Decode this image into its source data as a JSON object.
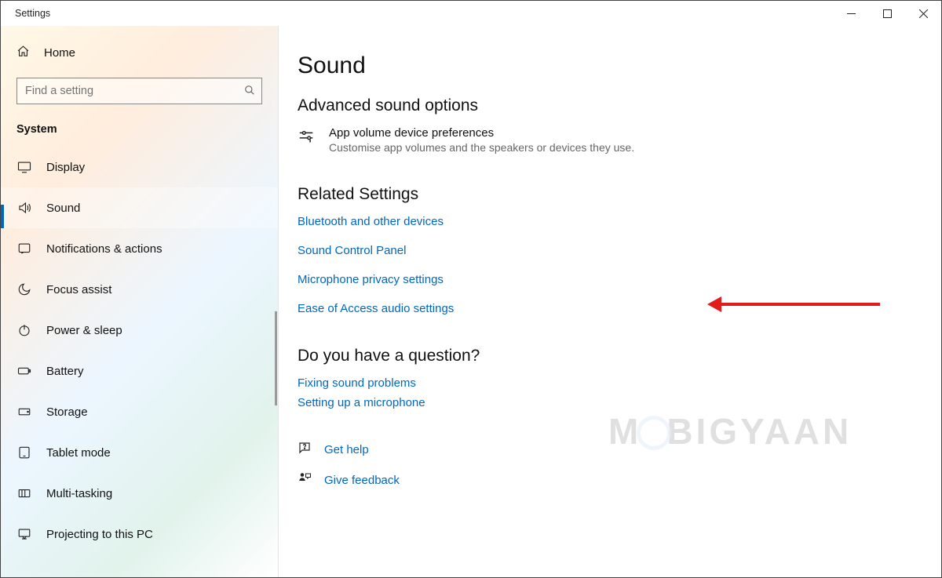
{
  "titlebar": {
    "title": "Settings"
  },
  "sidebar": {
    "home_label": "Home",
    "search_placeholder": "Find a setting",
    "section_label": "System",
    "items": [
      {
        "label": "Display",
        "icon": "display-icon"
      },
      {
        "label": "Sound",
        "icon": "sound-icon",
        "active": true
      },
      {
        "label": "Notifications & actions",
        "icon": "notifications-icon"
      },
      {
        "label": "Focus assist",
        "icon": "moon-icon"
      },
      {
        "label": "Power & sleep",
        "icon": "power-icon"
      },
      {
        "label": "Battery",
        "icon": "battery-icon"
      },
      {
        "label": "Storage",
        "icon": "storage-icon"
      },
      {
        "label": "Tablet mode",
        "icon": "tablet-icon"
      },
      {
        "label": "Multi-tasking",
        "icon": "multitask-icon"
      },
      {
        "label": "Projecting to this PC",
        "icon": "project-icon"
      }
    ]
  },
  "content": {
    "page_title": "Sound",
    "advanced": {
      "heading": "Advanced sound options",
      "item_title": "App volume  device preferences",
      "item_sub": "Customise app volumes and the speakers or devices they use."
    },
    "related": {
      "heading": "Related Settings",
      "links": [
        "Bluetooth and other devices",
        "Sound Control Panel",
        "Microphone privacy settings",
        "Ease of Access audio settings"
      ]
    },
    "question": {
      "heading": "Do you have a question?",
      "links": [
        "Fixing sound problems",
        "Setting up a microphone"
      ]
    },
    "help": {
      "get_help": "Get help",
      "give_feedback": "Give feedback"
    }
  },
  "watermark": {
    "left": "M",
    "right": "BIGYAAN"
  }
}
